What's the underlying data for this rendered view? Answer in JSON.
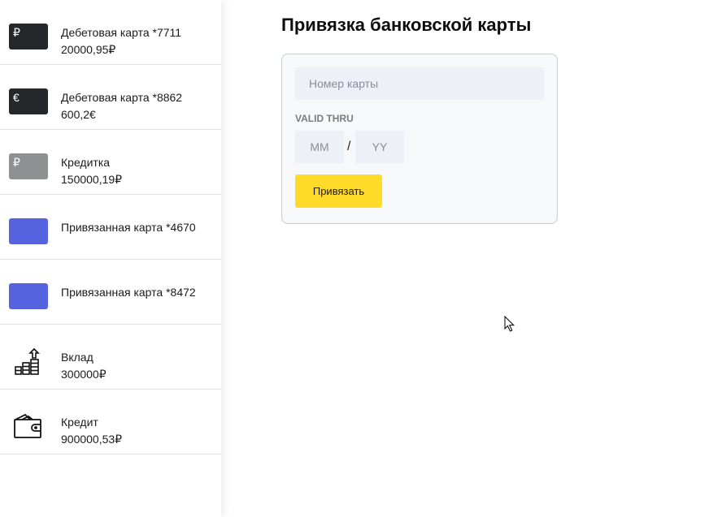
{
  "sidebar": {
    "accounts": [
      {
        "title": "Дебетовая карта *7711",
        "amount": "20000,95₽",
        "symbol": "₽",
        "icon": "debit-card-icon"
      },
      {
        "title": "Дебетовая карта *8862",
        "amount": "600,2€",
        "symbol": "€",
        "icon": "debit-card-icon"
      },
      {
        "title": "Кредитка",
        "amount": "150000,19₽",
        "symbol": "₽",
        "icon": "credit-card-icon"
      },
      {
        "title": "Привязанная карта *4670",
        "amount": "",
        "icon": "linked-card-icon"
      },
      {
        "title": "Привязанная карта *8472",
        "amount": "",
        "icon": "linked-card-icon"
      },
      {
        "title": "Вклад",
        "amount": "300000₽",
        "icon": "deposit-coins-icon"
      },
      {
        "title": "Кредит",
        "amount": "900000,53₽",
        "icon": "wallet-icon"
      }
    ]
  },
  "main": {
    "title": "Привязка банковской карты",
    "form": {
      "card_number_placeholder": "Номер карты",
      "card_number_value": "",
      "valid_thru_label": "VALID THRU",
      "month_placeholder": "MM",
      "year_placeholder": "YY",
      "separator": "/",
      "submit_label": "Привязать"
    }
  },
  "colors": {
    "accent_yellow": "#ffdb29",
    "card_dark": "#26272b",
    "card_grey": "#8f9092",
    "card_linked_blue": "#5563de",
    "input_bg": "#edf0f6",
    "form_bg": "#f6f8f9"
  }
}
